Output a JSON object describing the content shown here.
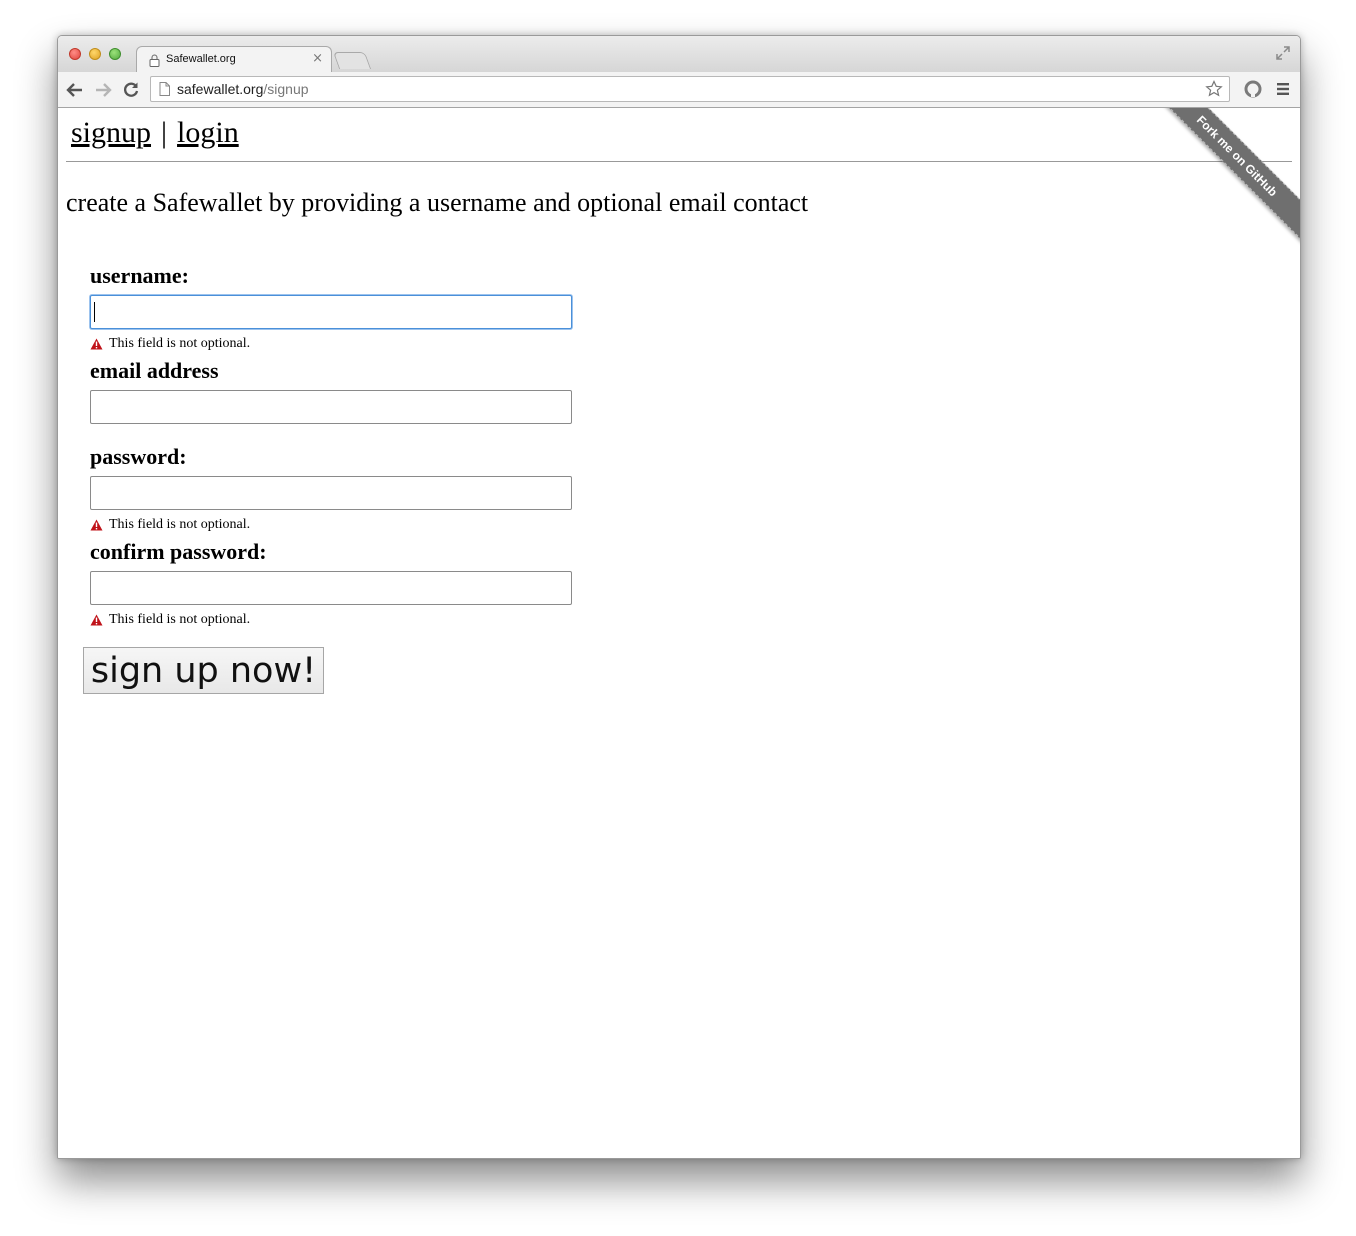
{
  "browser": {
    "tab_title": "Safewallet.org",
    "tab_close": "×",
    "url_host": "safewallet.org",
    "url_path": "/signup"
  },
  "nav": {
    "signup": "signup",
    "separator": "|",
    "login": "login"
  },
  "ribbon": {
    "label": "Fork me on GitHub"
  },
  "intro": "create a Safewallet by providing a username and optional email contact",
  "form": {
    "username_label": "username:",
    "username_value": "",
    "username_error": "This field is not optional.",
    "email_label": "email address",
    "email_value": "",
    "password_label": "password:",
    "password_value": "",
    "password_error": "This field is not optional.",
    "confirm_label": "confirm password:",
    "confirm_value": "",
    "confirm_error": "This field is not optional.",
    "submit_label": "sign up now!"
  },
  "colors": {
    "error_icon": "#c0131a",
    "focus_ring": "#4a90d9",
    "ribbon": "#6f6f6f"
  }
}
